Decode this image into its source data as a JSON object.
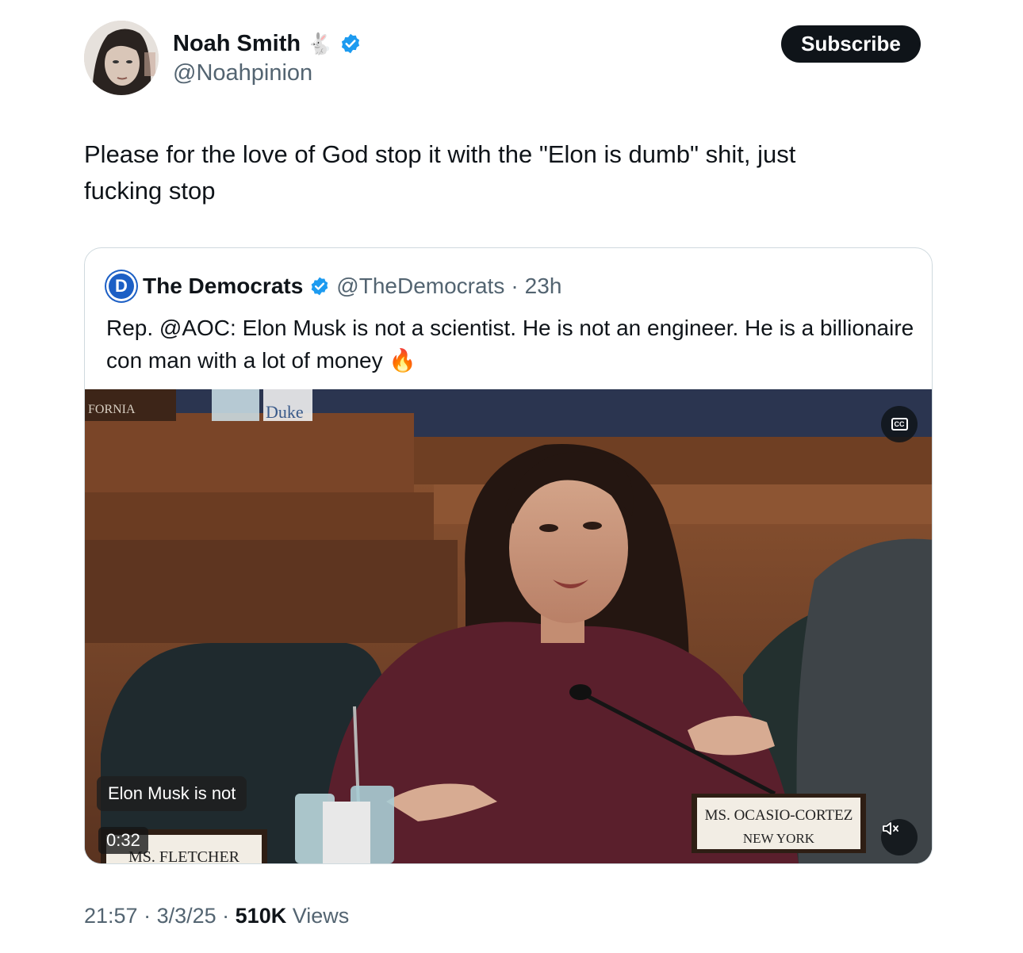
{
  "author": {
    "name": "Noah Smith",
    "emoji": "🐇",
    "handle": "@Noahpinion",
    "verified": true
  },
  "subscribe_label": "Subscribe",
  "tweet_text": "Please for the love of God stop it with the \"Elon is dumb\" shit, just\nfucking stop",
  "quote": {
    "logo_letter": "D",
    "name": "The Democrats",
    "handle": "@TheDemocrats",
    "separator": "·",
    "time": "23h",
    "text": "Rep. @AOC: Elon Musk is not a scientist. He is not an engineer. He is a billionaire con man with a lot of money 🔥",
    "video": {
      "caption": "Elon Musk is not",
      "duration": "0:32",
      "cc_label": "CC",
      "nameplate_main_line1": "MS. OCASIO-CORTEZ",
      "nameplate_main_line2": "NEW YORK",
      "nameplate_left": "MS. FLETCHER",
      "nameplate_top_left": "FORNIA",
      "bottle_label": "Duke"
    }
  },
  "footer": {
    "time": "21:57",
    "sep1": " · ",
    "date": "3/3/25",
    "sep2": " · ",
    "views_count": "510K",
    "views_label": " Views"
  },
  "colors": {
    "accent_blue": "#1d9bf0",
    "text_primary": "#0f1419",
    "text_secondary": "#536471",
    "border": "#cfd9de",
    "dem_blue": "#1c5fc5"
  }
}
